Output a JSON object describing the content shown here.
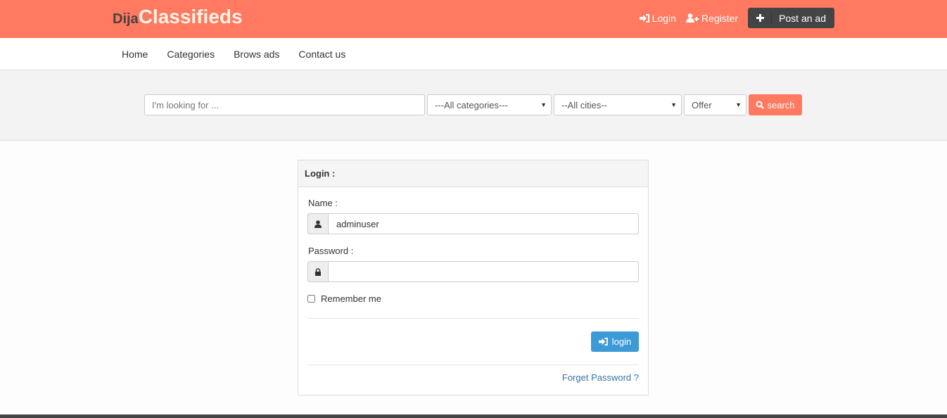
{
  "header": {
    "logo_part1": "Dija",
    "logo_part2": "Classifieds",
    "login": "Login",
    "register": "Register",
    "post_ad": "Post an ad"
  },
  "nav": {
    "items": [
      "Home",
      "Categories",
      "Brows ads",
      "Contact us"
    ]
  },
  "search": {
    "placeholder": "I'm looking for ...",
    "category": "---All categories---",
    "city": "--All cities--",
    "type": "Offer",
    "button": "search"
  },
  "login": {
    "title": "Login :",
    "name_label": "Name :",
    "name_value": "adminuser",
    "password_label": "Password :",
    "password_value": "",
    "remember": "Remember me",
    "button": "login",
    "forgot": "Forget Password ?"
  },
  "colors": {
    "brand": "#ff7a60",
    "primary": "#3c9ad6"
  }
}
